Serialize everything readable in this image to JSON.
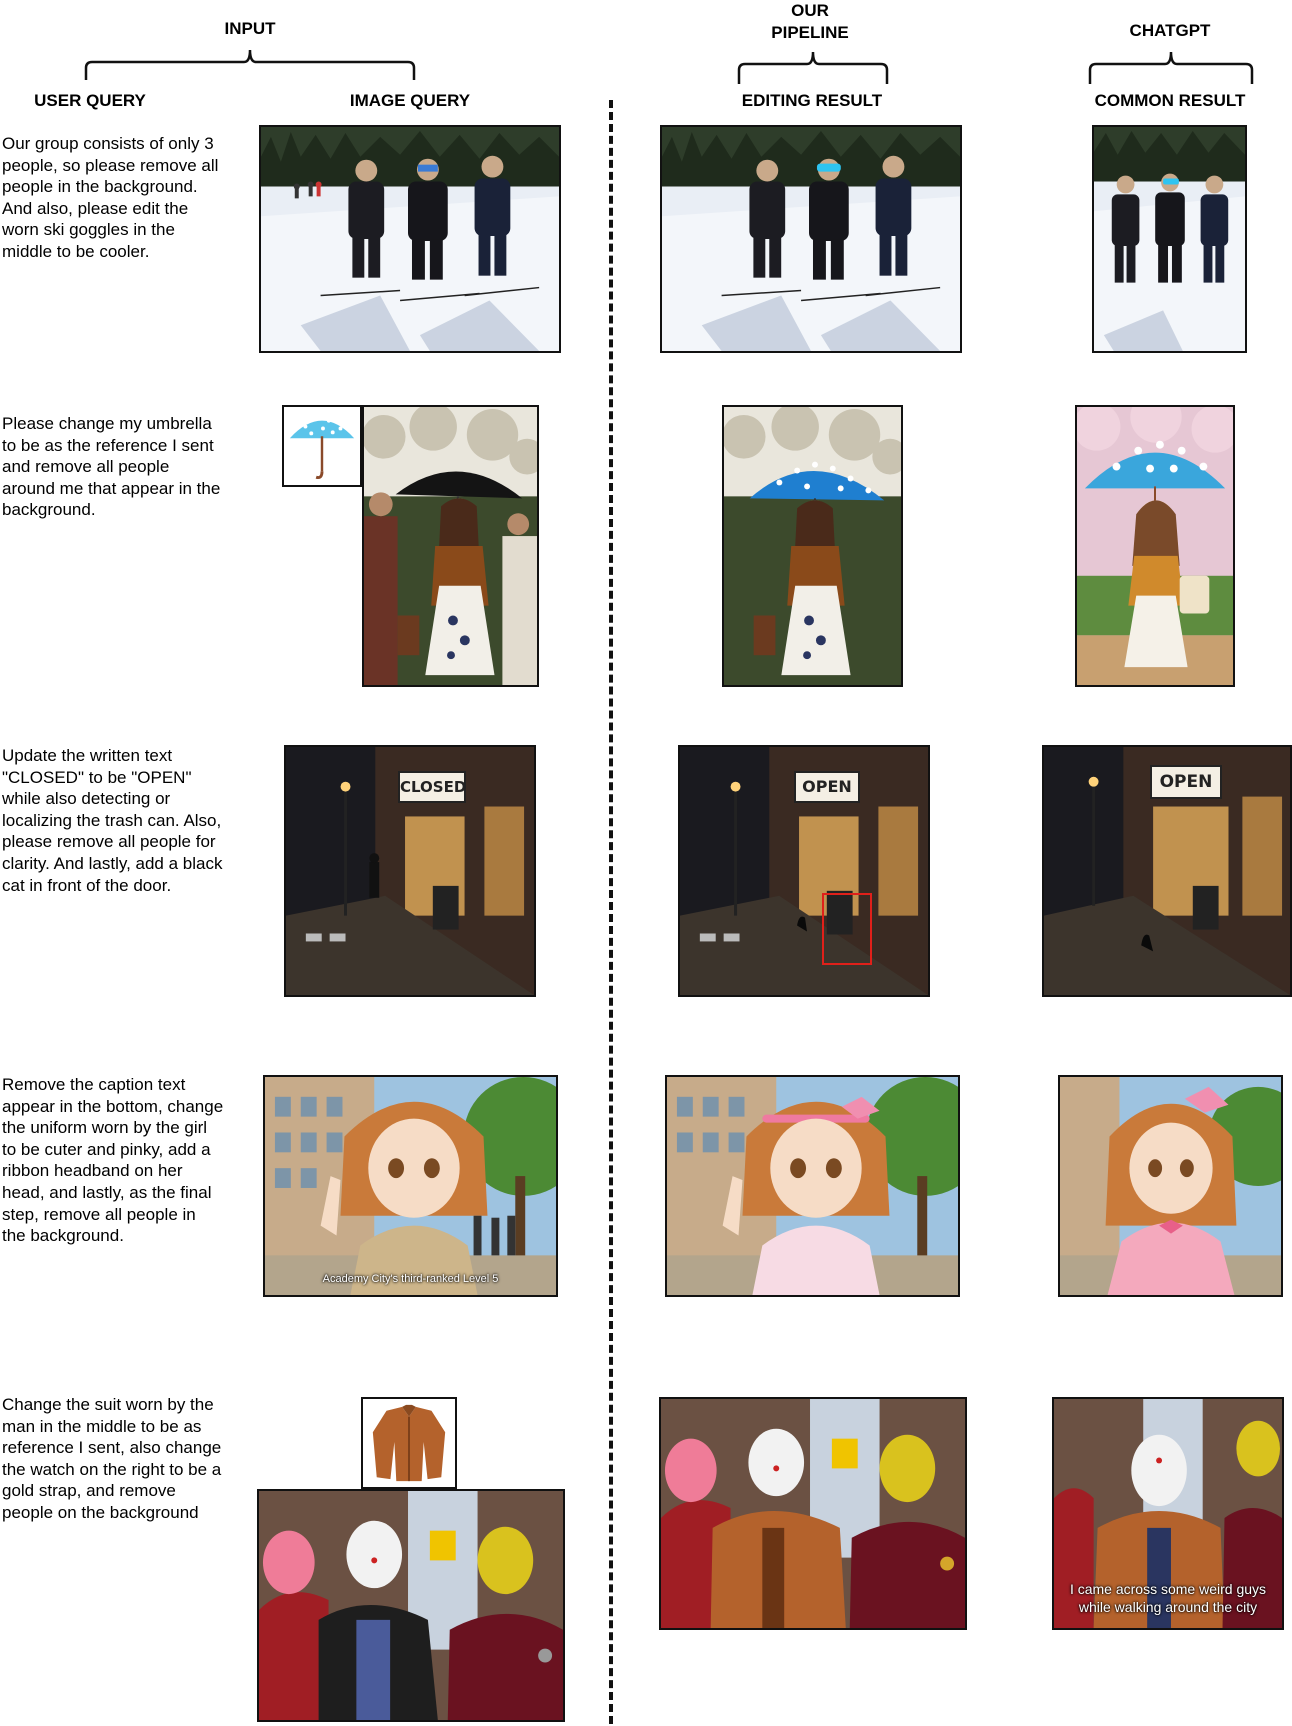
{
  "headers": {
    "input": "INPUT",
    "our_pipeline": "OUR\nPIPELINE",
    "chatgpt": "CHATGPT",
    "user_query": "USER QUERY",
    "image_query": "IMAGE QUERY",
    "editing_result": "EDITING RESULT",
    "common_result": "COMMON RESULT"
  },
  "rows": [
    {
      "query": "Our group consists of only 3 people, so please remove all people in the background. And also, please edit the worn ski goggles in the middle to be cooler."
    },
    {
      "query": "Please change my umbrella to be as the reference I sent and remove all people around me that appear in the background."
    },
    {
      "query": "Update the written text \"CLOSED\" to be \"OPEN\" while also detecting or localizing the trash can. Also, please remove all people for clarity. And lastly, add a black cat in front of the door.",
      "sign_input": "CLOSED",
      "sign_ours": "OPEN",
      "sign_chatgpt": "OPEN"
    },
    {
      "query": "Remove the caption text appear in the bottom, change the uniform worn by the girl to be cuter and pinky, add a ribbon headband on her head, and lastly, as the final step, remove all people in the background.",
      "caption_input": "Academy City's third-ranked Level 5"
    },
    {
      "query": "Change the suit worn by the man in the middle to be as reference I sent, also change the watch on the right to be a gold strap, and remove people on the background",
      "caption_chatgpt_line1": "I came across some weird guys",
      "caption_chatgpt_line2": "while walking around the city"
    }
  ],
  "colors": {
    "detection_box": "#e0201a",
    "divider": "#111111"
  }
}
